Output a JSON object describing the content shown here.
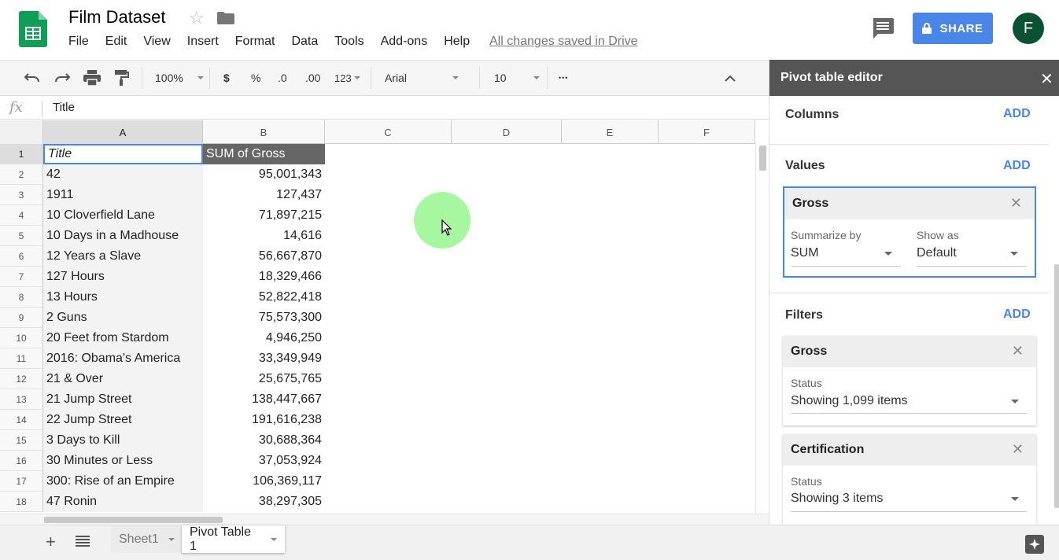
{
  "app": {
    "doc_title": "Film Dataset",
    "save_status": "All changes saved in Drive",
    "share_label": "SHARE",
    "avatar_initial": "F",
    "brand_color": "#0f9d58",
    "accent_color": "#4a86e8"
  },
  "menu": [
    "File",
    "Edit",
    "View",
    "Insert",
    "Format",
    "Data",
    "Tools",
    "Add-ons",
    "Help"
  ],
  "toolbar": {
    "zoom": "100%",
    "currency": "$",
    "percent": "%",
    "dec_decrease": ".0",
    "dec_increase": ".00",
    "more_formats": "123",
    "font": "Arial",
    "font_size": "10",
    "more": "•••"
  },
  "formula_bar": {
    "fx": "fx",
    "value": "Title"
  },
  "columns": [
    "A",
    "B",
    "C",
    "D",
    "E",
    "F"
  ],
  "table": {
    "header": {
      "row": "1",
      "title": "Title",
      "gross": "SUM of Gross"
    },
    "rows": [
      {
        "n": "2",
        "title": "42",
        "gross": "95,001,343"
      },
      {
        "n": "3",
        "title": "1911",
        "gross": "127,437"
      },
      {
        "n": "4",
        "title": "10 Cloverfield Lane",
        "gross": "71,897,215"
      },
      {
        "n": "5",
        "title": "10 Days in a Madhouse",
        "gross": "14,616"
      },
      {
        "n": "6",
        "title": "12 Years a Slave",
        "gross": "56,667,870"
      },
      {
        "n": "7",
        "title": "127 Hours",
        "gross": "18,329,466"
      },
      {
        "n": "8",
        "title": "13 Hours",
        "gross": "52,822,418"
      },
      {
        "n": "9",
        "title": "2 Guns",
        "gross": "75,573,300"
      },
      {
        "n": "10",
        "title": "20 Feet from Stardom",
        "gross": "4,946,250"
      },
      {
        "n": "11",
        "title": "2016: Obama's America",
        "gross": "33,349,949"
      },
      {
        "n": "12",
        "title": "21 & Over",
        "gross": "25,675,765"
      },
      {
        "n": "13",
        "title": "21 Jump Street",
        "gross": "138,447,667"
      },
      {
        "n": "14",
        "title": "22 Jump Street",
        "gross": "191,616,238"
      },
      {
        "n": "15",
        "title": "3 Days to Kill",
        "gross": "30,688,364"
      },
      {
        "n": "16",
        "title": "30 Minutes or Less",
        "gross": "37,053,924"
      },
      {
        "n": "17",
        "title": "300: Rise of an Empire",
        "gross": "106,369,117"
      },
      {
        "n": "18",
        "title": "47 Ronin",
        "gross": "38,297,305"
      }
    ]
  },
  "sheets": {
    "tabs": [
      "Sheet1",
      "Pivot Table 1"
    ],
    "active": "Pivot Table 1"
  },
  "pivot_editor": {
    "title": "Pivot table editor",
    "add_label": "ADD",
    "columns_label": "Columns",
    "values_label": "Values",
    "filters_label": "Filters",
    "value_card": {
      "field": "Gross",
      "summarize_label": "Summarize by",
      "summarize_value": "SUM",
      "show_as_label": "Show as",
      "show_as_value": "Default"
    },
    "filters": [
      {
        "field": "Gross",
        "status_label": "Status",
        "status_value": "Showing 1,099 items"
      },
      {
        "field": "Certification",
        "status_label": "Status",
        "status_value": "Showing 3 items"
      }
    ]
  }
}
